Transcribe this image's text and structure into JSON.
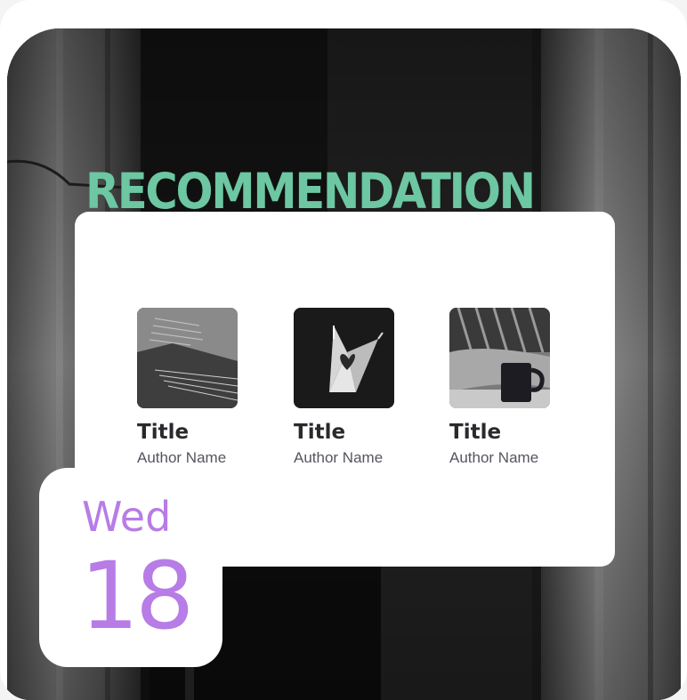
{
  "heading": "RECOMMENDATION",
  "books": [
    {
      "title": "Title",
      "author": "Author Name",
      "image": "open-book-pages-photo"
    },
    {
      "title": "Title",
      "author": "Author Name",
      "image": "book-heart-pages-photo"
    },
    {
      "title": "Title",
      "author": "Author Name",
      "image": "blanket-and-mug-photo"
    }
  ],
  "date": {
    "weekday": "Wed",
    "day": "18"
  },
  "colors": {
    "heading": "#6cc7a2",
    "date": "#b77ce6",
    "card": "#ffffff",
    "background_photo": "grayscale-building-columns"
  }
}
